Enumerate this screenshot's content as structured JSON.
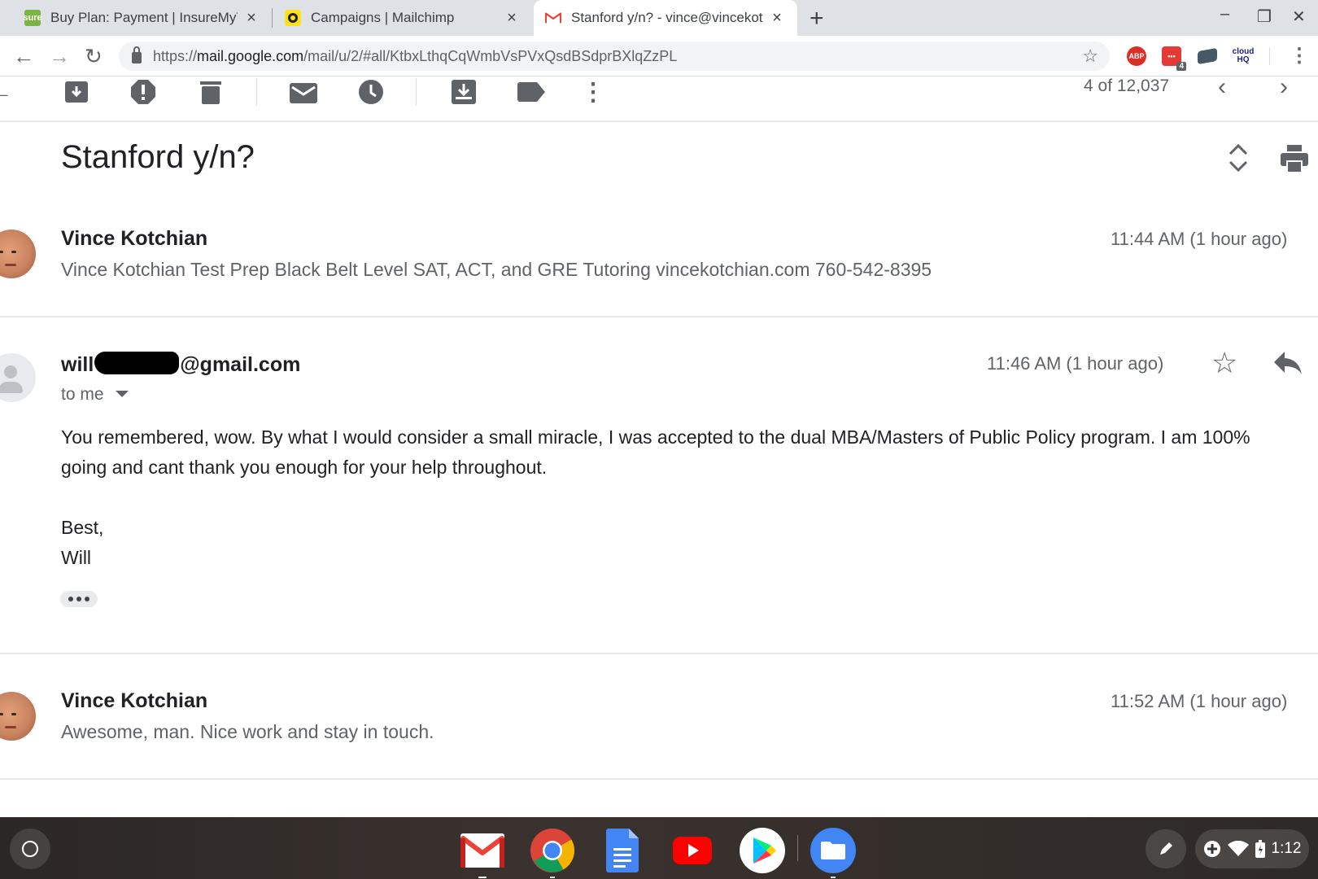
{
  "browser": {
    "tabs": [
      {
        "title": "Buy Plan: Payment | InsureMyTri",
        "favicon": "sure",
        "active": false
      },
      {
        "title": "Campaigns | Mailchimp",
        "favicon": "mailchimp-icon",
        "active": false
      },
      {
        "title": "Stanford y/n? - vince@vincekotc",
        "favicon": "gmail-icon",
        "active": true
      }
    ],
    "new_tab": "+",
    "url": {
      "scheme": "https://",
      "host": "mail.google.com",
      "path": "/mail/u/2/#all/KtbxLthqCqWmbVsPVxQsdBSdprBXlqZzPL"
    },
    "extensions": {
      "adblock": "ABP",
      "badge_count": "4",
      "cloudhq": "cloud HQ"
    }
  },
  "gmail": {
    "counter": "4 of 12,037",
    "subject": "Stanford y/n?",
    "messages": [
      {
        "sender": "Vince Kotchian",
        "snippet": "Vince Kotchian Test Prep Black Belt Level SAT, ACT, and GRE Tutoring vincekotchian.com 760-542-8395",
        "time": "11:44 AM (1 hour ago)"
      },
      {
        "sender_prefix": "will",
        "sender_suffix": "@gmail.com",
        "to_line": "to me",
        "time": "11:46 AM (1 hour ago)",
        "body_line1": "You remembered, wow. By what I would consider a small miracle, I was accepted to the dual MBA/Masters of Public Policy program. I am 100%",
        "body_line2": "going and cant thank you enough for your help throughout.",
        "signoff": "Best,",
        "signature": "Will"
      },
      {
        "sender": "Vince Kotchian",
        "snippet": "Awesome, man. Nice work and stay in touch.",
        "time": "11:52 AM (1 hour ago)"
      }
    ]
  },
  "shelf": {
    "apps": [
      "gmail-icon",
      "chrome-icon",
      "docs-icon",
      "youtube-icon",
      "play-store-icon",
      "files-icon"
    ],
    "time": "1:12"
  },
  "colors": {
    "tabstrip": "#dee1e6",
    "gmail_red": "#ea4335",
    "text_secondary": "#5f6368"
  }
}
